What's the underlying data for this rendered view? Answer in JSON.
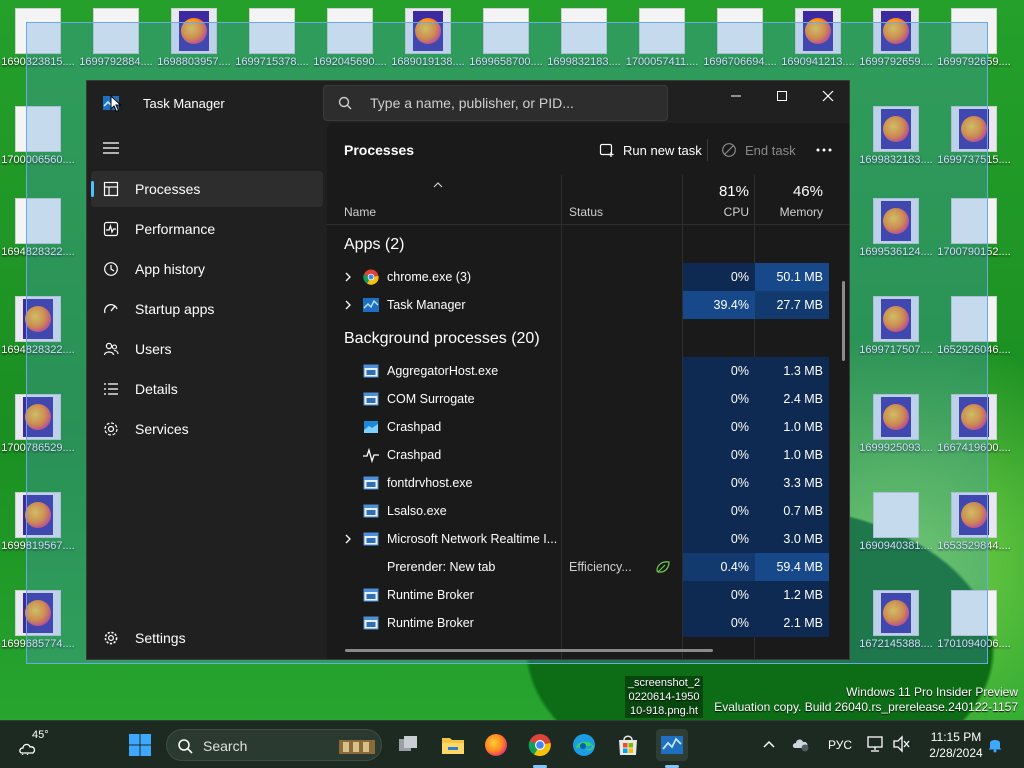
{
  "desktop": {
    "icons": [
      {
        "label": "1690323815....",
        "kind": "img"
      },
      {
        "label": "1699792884....",
        "kind": "img"
      },
      {
        "label": "1698803957....",
        "kind": "ff"
      },
      {
        "label": "1699715378....",
        "kind": "img"
      },
      {
        "label": "1692045690....",
        "kind": "img"
      },
      {
        "label": "1689019138....",
        "kind": "ff"
      },
      {
        "label": "1699658700....",
        "kind": "img"
      },
      {
        "label": "1699832183....",
        "kind": "img"
      },
      {
        "label": "1700057411....",
        "kind": "img"
      },
      {
        "label": "1696706694....",
        "kind": "img"
      },
      {
        "label": "1690941213....",
        "kind": "ff"
      },
      {
        "label": "1699792659....",
        "kind": "ff"
      },
      {
        "label": "1699792659....",
        "kind": "img"
      },
      {
        "label": "1700006560....",
        "kind": "img"
      },
      {
        "label": "1699832183....",
        "kind": "ff"
      },
      {
        "label": "1699737515....",
        "kind": "ff"
      },
      {
        "label": "1694828322....",
        "kind": "img"
      },
      {
        "label": "1699536124....",
        "kind": "ff"
      },
      {
        "label": "1700790152....",
        "kind": "img"
      },
      {
        "label": "1694828322....",
        "kind": "ff"
      },
      {
        "label": "1699717507....",
        "kind": "ff"
      },
      {
        "label": "1652926046....",
        "kind": "img"
      },
      {
        "label": "1700786529....",
        "kind": "ff"
      },
      {
        "label": "1699925093....",
        "kind": "ff"
      },
      {
        "label": "1667419600....",
        "kind": "ff"
      },
      {
        "label": "1699819567....",
        "kind": "ff"
      },
      {
        "label": "1690940381....",
        "kind": "img"
      },
      {
        "label": "1653529844....",
        "kind": "ff"
      },
      {
        "label": "1699685774....",
        "kind": "ff"
      },
      {
        "label": "1672145388....",
        "kind": "ff"
      },
      {
        "label": "1701094006....",
        "kind": "img"
      }
    ],
    "screenshot_label": "_screenshot_2 0220614-1950 10-918.png.ht",
    "watermark_line1": "Windows 11 Pro Insider Preview",
    "watermark_line2": "Evaluation copy. Build 26040.rs_prerelease.240122-1157"
  },
  "task_manager": {
    "title": "Task Manager",
    "search_placeholder": "Type a name, publisher, or PID...",
    "nav": [
      {
        "label": "Processes",
        "icon": "processes-icon",
        "active": true
      },
      {
        "label": "Performance",
        "icon": "performance-icon"
      },
      {
        "label": "App history",
        "icon": "app-history-icon"
      },
      {
        "label": "Startup apps",
        "icon": "startup-apps-icon"
      },
      {
        "label": "Users",
        "icon": "users-icon"
      },
      {
        "label": "Details",
        "icon": "details-icon"
      },
      {
        "label": "Services",
        "icon": "services-icon"
      }
    ],
    "settings_label": "Settings",
    "page_title": "Processes",
    "run_new_task": "Run new task",
    "end_task": "End task",
    "columns": {
      "name": "Name",
      "status": "Status",
      "cpu_pct": "81%",
      "cpu": "CPU",
      "mem_pct": "46%",
      "memory": "Memory"
    },
    "apps_group": "Apps (2)",
    "apps": [
      {
        "name": "chrome.exe (3)",
        "status": "",
        "cpu": "0%",
        "mem": "50.1 MB",
        "expandable": true,
        "icon": "chrome-icon"
      },
      {
        "name": "Task Manager",
        "status": "",
        "cpu": "39.4%",
        "mem": "27.7 MB",
        "expandable": true,
        "icon": "task-manager-icon"
      }
    ],
    "bg_group": "Background processes (20)",
    "background": [
      {
        "name": "AggregatorHost.exe",
        "status": "",
        "cpu": "0%",
        "mem": "1.3 MB",
        "icon": "window-icon"
      },
      {
        "name": "COM Surrogate",
        "status": "",
        "cpu": "0%",
        "mem": "2.4 MB",
        "icon": "window-icon"
      },
      {
        "name": "Crashpad",
        "status": "",
        "cpu": "0%",
        "mem": "1.0 MB",
        "icon": "crashpad-icon"
      },
      {
        "name": "Crashpad",
        "status": "",
        "cpu": "0%",
        "mem": "1.0 MB",
        "icon": "pulse-icon"
      },
      {
        "name": "fontdrvhost.exe",
        "status": "",
        "cpu": "0%",
        "mem": "3.3 MB",
        "icon": "window-icon"
      },
      {
        "name": "Lsalso.exe",
        "status": "",
        "cpu": "0%",
        "mem": "0.7 MB",
        "icon": "window-icon"
      },
      {
        "name": "Microsoft Network Realtime I...",
        "status": "",
        "cpu": "0%",
        "mem": "3.0 MB",
        "expandable": true,
        "icon": "window-icon"
      },
      {
        "name": "Prerender: New tab",
        "status": "Efficiency...",
        "cpu": "0.4%",
        "mem": "59.4 MB",
        "efficiency": true,
        "icon": ""
      },
      {
        "name": "Runtime Broker",
        "status": "",
        "cpu": "0%",
        "mem": "1.2 MB",
        "icon": "window-icon"
      },
      {
        "name": "Runtime Broker",
        "status": "",
        "cpu": "0%",
        "mem": "2.1 MB",
        "icon": "window-icon"
      }
    ]
  },
  "taskbar": {
    "temperature": "45°",
    "search_label": "Search",
    "language": "РУС",
    "time": "11:15 PM",
    "date": "2/28/2024"
  },
  "colors": {
    "accent": "#4cc2ff",
    "heat_low": "#0e2a52",
    "heat_mid": "#123a6e",
    "heat_high": "#17498a"
  }
}
